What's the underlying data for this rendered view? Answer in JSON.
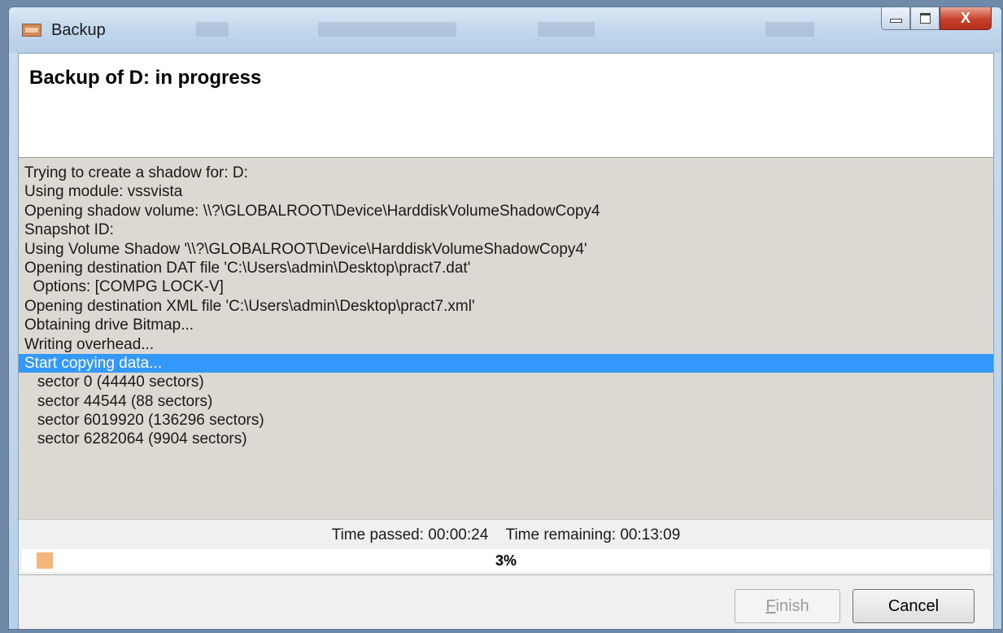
{
  "window": {
    "title": "Backup",
    "controls": {
      "minimize_icon": "minimize-icon",
      "maximize_icon": "maximize-icon",
      "close_icon": "close-icon",
      "close_glyph": "X"
    }
  },
  "header": {
    "title": "Backup of D: in progress"
  },
  "log": {
    "lines": [
      "Trying to create a shadow for: D:",
      "Using module: vssvista",
      "Opening shadow volume: \\\\?\\GLOBALROOT\\Device\\HarddiskVolumeShadowCopy4",
      "Snapshot ID:",
      "Using Volume Shadow '\\\\?\\GLOBALROOT\\Device\\HarddiskVolumeShadowCopy4'",
      "Opening destination DAT file 'C:\\Users\\admin\\Desktop\\pract7.dat'",
      "  Options: [COMPG LOCK-V]",
      "Opening destination XML file 'C:\\Users\\admin\\Desktop\\pract7.xml'",
      "Obtaining drive Bitmap...",
      "Writing overhead...",
      "Start copying data...",
      "   sector 0 (44440 sectors)",
      "   sector 44544 (88 sectors)",
      "   sector 6019920 (136296 sectors)",
      "   sector 6282064 (9904 sectors)"
    ],
    "selected_index": 10
  },
  "status": {
    "time_passed": "Time passed: 00:00:24",
    "time_remaining": "Time remaining: 00:13:09",
    "progress_text": "3%",
    "progress_value": 0.03,
    "progress_color": "#f6b57a"
  },
  "buttons": {
    "finish_first": "F",
    "finish_rest": "inish",
    "cancel": "Cancel"
  },
  "colors": {
    "selection": "#3399ff",
    "log_background": "#dcd8d2"
  }
}
